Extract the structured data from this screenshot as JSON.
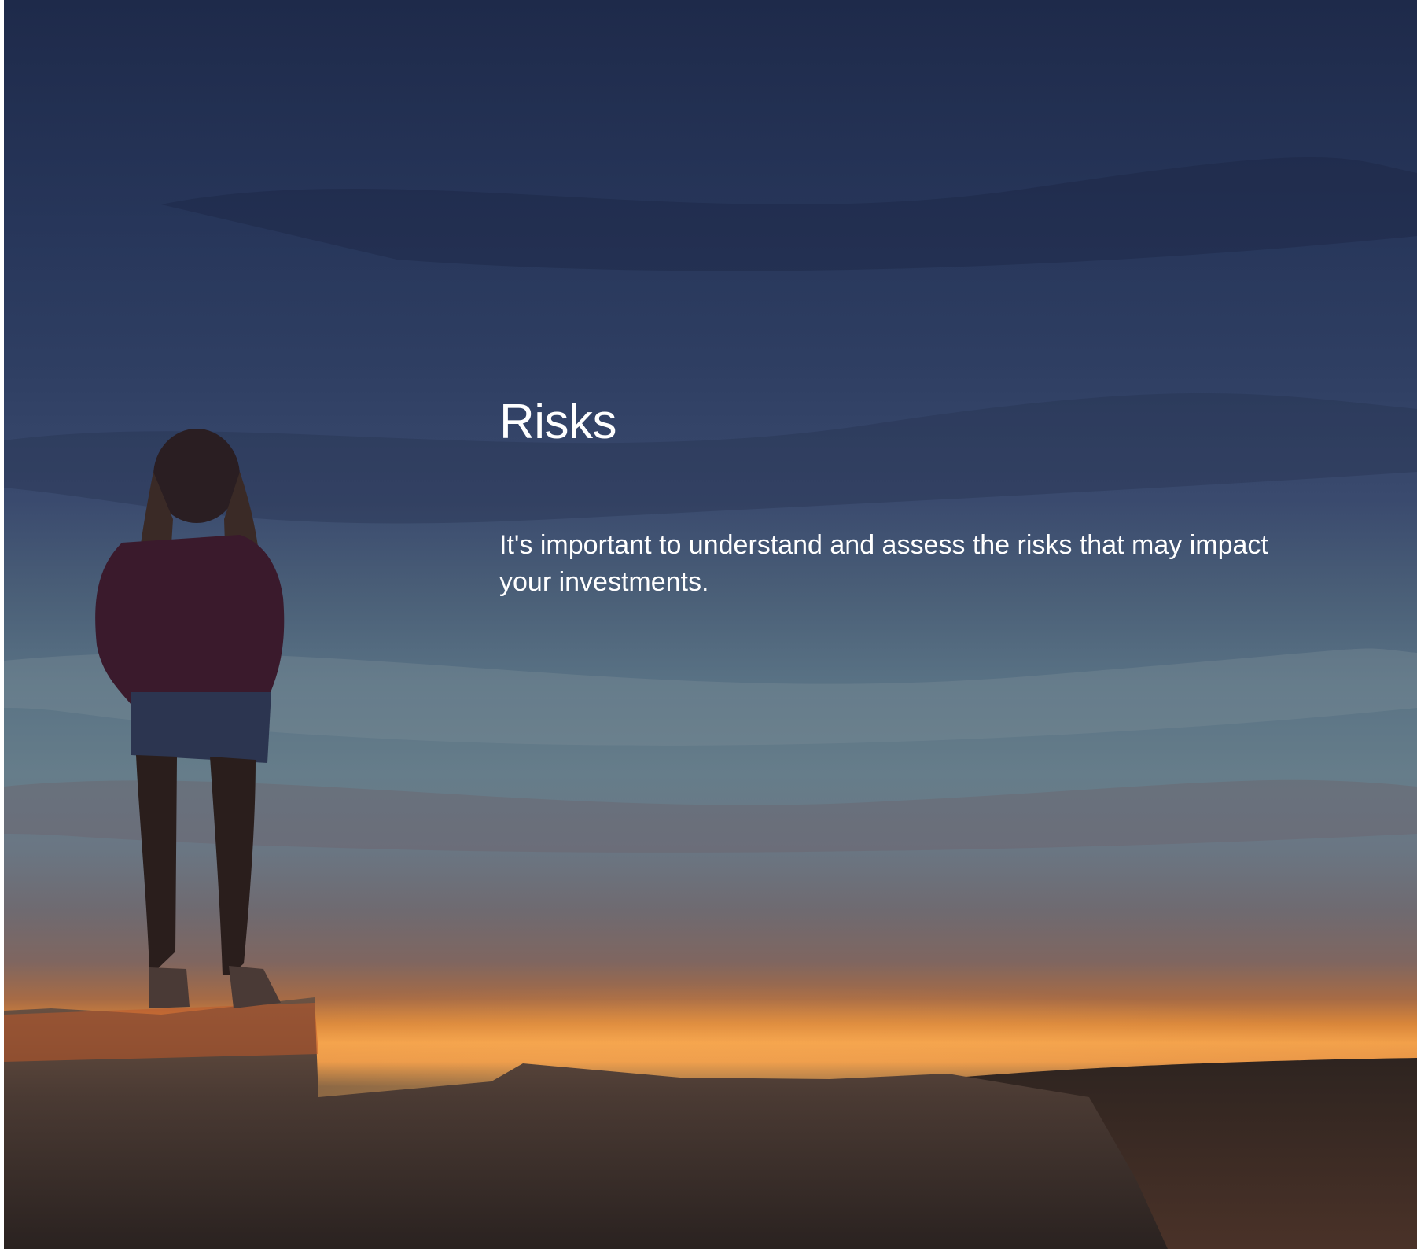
{
  "hero": {
    "title": "Risks",
    "description": "It's important to understand and assess the risks that may impact your investments."
  },
  "colors": {
    "text": "#ffffff",
    "sky_top": "#1e2a4a",
    "sky_mid": "#667d8a",
    "horizon_glow": "#f2a04a",
    "rock": "#3a2f2c"
  },
  "background_image": "person-silhouette-on-cliff-at-sunset"
}
